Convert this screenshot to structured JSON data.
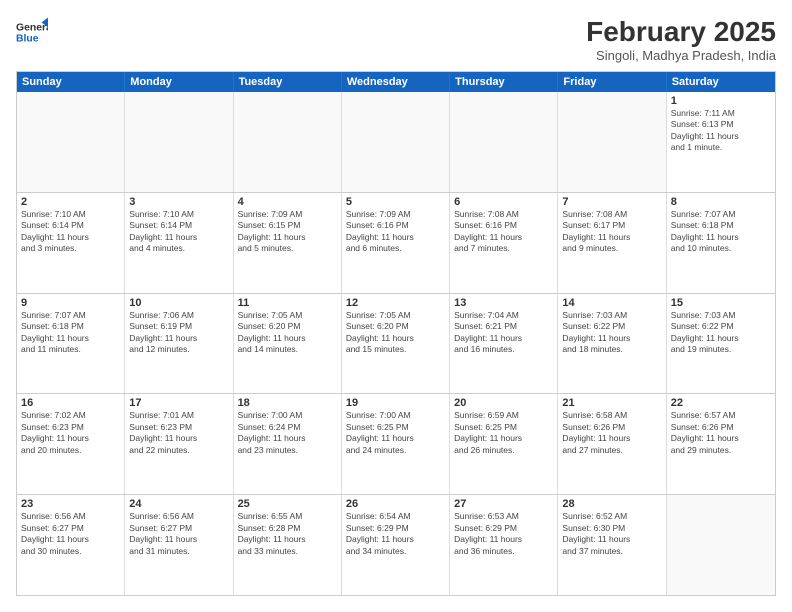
{
  "header": {
    "logo_general": "General",
    "logo_blue": "Blue",
    "month_title": "February 2025",
    "subtitle": "Singoli, Madhya Pradesh, India"
  },
  "days_of_week": [
    "Sunday",
    "Monday",
    "Tuesday",
    "Wednesday",
    "Thursday",
    "Friday",
    "Saturday"
  ],
  "weeks": [
    [
      {
        "day": "",
        "info": ""
      },
      {
        "day": "",
        "info": ""
      },
      {
        "day": "",
        "info": ""
      },
      {
        "day": "",
        "info": ""
      },
      {
        "day": "",
        "info": ""
      },
      {
        "day": "",
        "info": ""
      },
      {
        "day": "1",
        "info": "Sunrise: 7:11 AM\nSunset: 6:13 PM\nDaylight: 11 hours\nand 1 minute."
      }
    ],
    [
      {
        "day": "2",
        "info": "Sunrise: 7:10 AM\nSunset: 6:14 PM\nDaylight: 11 hours\nand 3 minutes."
      },
      {
        "day": "3",
        "info": "Sunrise: 7:10 AM\nSunset: 6:14 PM\nDaylight: 11 hours\nand 4 minutes."
      },
      {
        "day": "4",
        "info": "Sunrise: 7:09 AM\nSunset: 6:15 PM\nDaylight: 11 hours\nand 5 minutes."
      },
      {
        "day": "5",
        "info": "Sunrise: 7:09 AM\nSunset: 6:16 PM\nDaylight: 11 hours\nand 6 minutes."
      },
      {
        "day": "6",
        "info": "Sunrise: 7:08 AM\nSunset: 6:16 PM\nDaylight: 11 hours\nand 7 minutes."
      },
      {
        "day": "7",
        "info": "Sunrise: 7:08 AM\nSunset: 6:17 PM\nDaylight: 11 hours\nand 9 minutes."
      },
      {
        "day": "8",
        "info": "Sunrise: 7:07 AM\nSunset: 6:18 PM\nDaylight: 11 hours\nand 10 minutes."
      }
    ],
    [
      {
        "day": "9",
        "info": "Sunrise: 7:07 AM\nSunset: 6:18 PM\nDaylight: 11 hours\nand 11 minutes."
      },
      {
        "day": "10",
        "info": "Sunrise: 7:06 AM\nSunset: 6:19 PM\nDaylight: 11 hours\nand 12 minutes."
      },
      {
        "day": "11",
        "info": "Sunrise: 7:05 AM\nSunset: 6:20 PM\nDaylight: 11 hours\nand 14 minutes."
      },
      {
        "day": "12",
        "info": "Sunrise: 7:05 AM\nSunset: 6:20 PM\nDaylight: 11 hours\nand 15 minutes."
      },
      {
        "day": "13",
        "info": "Sunrise: 7:04 AM\nSunset: 6:21 PM\nDaylight: 11 hours\nand 16 minutes."
      },
      {
        "day": "14",
        "info": "Sunrise: 7:03 AM\nSunset: 6:22 PM\nDaylight: 11 hours\nand 18 minutes."
      },
      {
        "day": "15",
        "info": "Sunrise: 7:03 AM\nSunset: 6:22 PM\nDaylight: 11 hours\nand 19 minutes."
      }
    ],
    [
      {
        "day": "16",
        "info": "Sunrise: 7:02 AM\nSunset: 6:23 PM\nDaylight: 11 hours\nand 20 minutes."
      },
      {
        "day": "17",
        "info": "Sunrise: 7:01 AM\nSunset: 6:23 PM\nDaylight: 11 hours\nand 22 minutes."
      },
      {
        "day": "18",
        "info": "Sunrise: 7:00 AM\nSunset: 6:24 PM\nDaylight: 11 hours\nand 23 minutes."
      },
      {
        "day": "19",
        "info": "Sunrise: 7:00 AM\nSunset: 6:25 PM\nDaylight: 11 hours\nand 24 minutes."
      },
      {
        "day": "20",
        "info": "Sunrise: 6:59 AM\nSunset: 6:25 PM\nDaylight: 11 hours\nand 26 minutes."
      },
      {
        "day": "21",
        "info": "Sunrise: 6:58 AM\nSunset: 6:26 PM\nDaylight: 11 hours\nand 27 minutes."
      },
      {
        "day": "22",
        "info": "Sunrise: 6:57 AM\nSunset: 6:26 PM\nDaylight: 11 hours\nand 29 minutes."
      }
    ],
    [
      {
        "day": "23",
        "info": "Sunrise: 6:56 AM\nSunset: 6:27 PM\nDaylight: 11 hours\nand 30 minutes."
      },
      {
        "day": "24",
        "info": "Sunrise: 6:56 AM\nSunset: 6:27 PM\nDaylight: 11 hours\nand 31 minutes."
      },
      {
        "day": "25",
        "info": "Sunrise: 6:55 AM\nSunset: 6:28 PM\nDaylight: 11 hours\nand 33 minutes."
      },
      {
        "day": "26",
        "info": "Sunrise: 6:54 AM\nSunset: 6:29 PM\nDaylight: 11 hours\nand 34 minutes."
      },
      {
        "day": "27",
        "info": "Sunrise: 6:53 AM\nSunset: 6:29 PM\nDaylight: 11 hours\nand 36 minutes."
      },
      {
        "day": "28",
        "info": "Sunrise: 6:52 AM\nSunset: 6:30 PM\nDaylight: 11 hours\nand 37 minutes."
      },
      {
        "day": "",
        "info": ""
      }
    ]
  ]
}
